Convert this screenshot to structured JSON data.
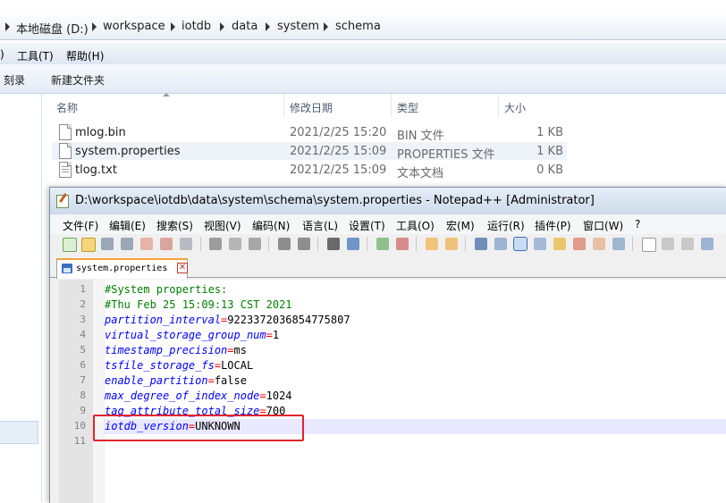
{
  "explorer": {
    "breadcrumb": [
      "本地磁盘 (D:)",
      "workspace",
      "iotdb",
      "data",
      "system",
      "schema"
    ],
    "menu": [
      "工具(T)",
      "帮助(H)"
    ],
    "menu_partial": ")",
    "commands": [
      "刻录",
      "新建文件夹"
    ],
    "columns": {
      "name": "名称",
      "date": "修改日期",
      "type": "类型",
      "size": "大小"
    },
    "files": [
      {
        "name": "mlog.bin",
        "date": "2021/2/25 15:20",
        "type": "BIN 文件",
        "size": "1 KB",
        "icon": "file-icon"
      },
      {
        "name": "system.properties",
        "date": "2021/2/25 15:09",
        "type": "PROPERTIES 文件",
        "size": "1 KB",
        "icon": "file-icon",
        "selected": true
      },
      {
        "name": "tlog.txt",
        "date": "2021/2/25 15:09",
        "type": "文本文档",
        "size": "0 KB",
        "icon": "text-file-icon"
      }
    ]
  },
  "notepad": {
    "title": "D:\\workspace\\iotdb\\data\\system\\schema\\system.properties - Notepad++ [Administrator]",
    "menu": [
      "文件(F)",
      "编辑(E)",
      "搜索(S)",
      "视图(V)",
      "编码(N)",
      "语言(L)",
      "设置(T)",
      "工具(O)",
      "宏(M)",
      "运行(R)",
      "插件(P)",
      "窗口(W)",
      "?"
    ],
    "tab_label": "system.properties",
    "tab_close": "✕",
    "lines": [
      {
        "num": "1",
        "comment": "#System properties:"
      },
      {
        "num": "2",
        "comment": "#Thu Feb 25 15:09:13 CST 2021"
      },
      {
        "num": "3",
        "key": "partition_interval",
        "eq": "=",
        "value": "9223372036854775807"
      },
      {
        "num": "4",
        "key": "virtual_storage_group_num",
        "eq": "=",
        "value": "1"
      },
      {
        "num": "5",
        "key": "timestamp_precision",
        "eq": "=",
        "value": "ms"
      },
      {
        "num": "6",
        "key": "tsfile_storage_fs",
        "eq": "=",
        "value": "LOCAL"
      },
      {
        "num": "7",
        "key": "enable_partition",
        "eq": "=",
        "value": "false"
      },
      {
        "num": "8",
        "key": "max_degree_of_index_node",
        "eq": "=",
        "value": "1024"
      },
      {
        "num": "9",
        "key": "tag_attribute_total_size",
        "eq": "=",
        "value": "700"
      },
      {
        "num": "10",
        "key": "iotdb_version",
        "eq": "=",
        "value": "UNKNOWN",
        "current": true
      },
      {
        "num": "11"
      }
    ],
    "colors": {
      "comment": "#008000",
      "key": "#0000ff",
      "operator": "#ff0000",
      "annotation_box": "#e0242b"
    }
  }
}
